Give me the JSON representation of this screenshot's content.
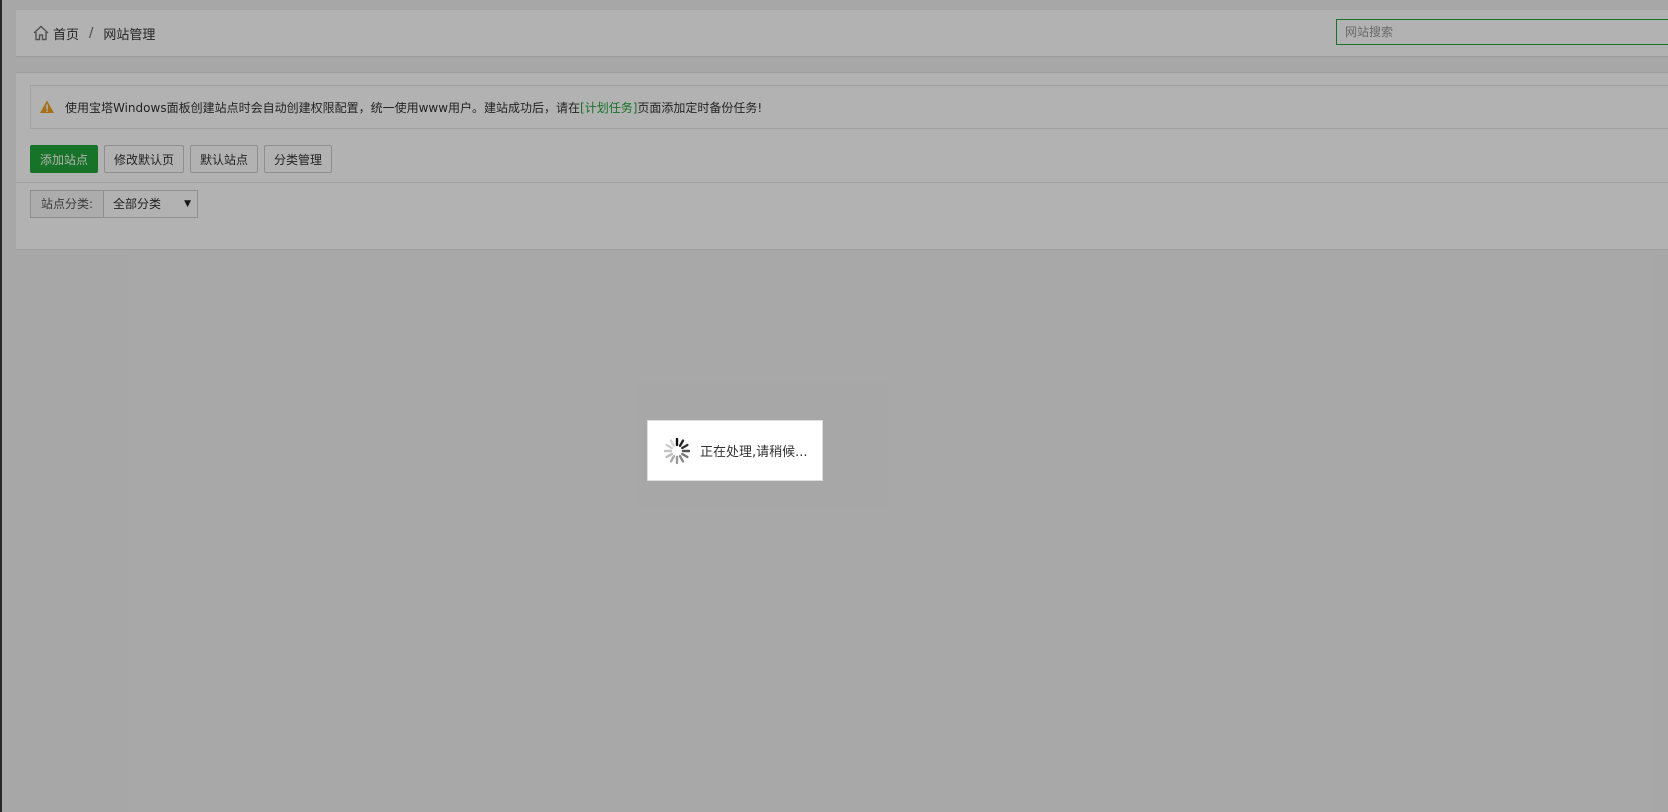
{
  "breadcrumb": {
    "home": "首页",
    "separator": "/",
    "current": "网站管理",
    "home_icon": "home-icon"
  },
  "search": {
    "placeholder": "网站搜索",
    "value": "",
    "border_color": "#20a53a"
  },
  "notice": {
    "icon": "warning-icon",
    "icon_color": "#f0a020",
    "text_before": "使用宝塔Windows面板创建站点时会自动创建权限配置，统一使用www用户。建站成功后，请在",
    "link": "[计划任务]",
    "text_after": "页面添加定时备份任务!"
  },
  "toolbar": {
    "add_site": "添加站点",
    "edit_default_page": "修改默认页",
    "default_site": "默认站点",
    "category_manage": "分类管理"
  },
  "category": {
    "label": "站点分类:",
    "selected": "全部分类"
  },
  "loading": {
    "text": "正在处理,请稍候...",
    "icon": "spinner-icon"
  },
  "colors": {
    "primary": "#20a53a",
    "overlay": "rgba(0,0,0,0.3)"
  }
}
